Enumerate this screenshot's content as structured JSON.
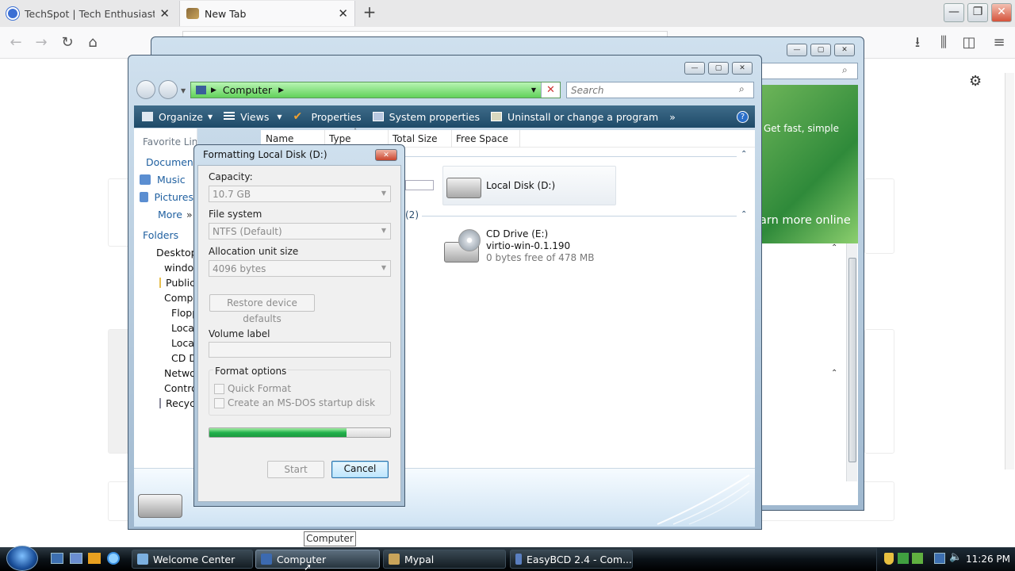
{
  "browser": {
    "tabs": [
      {
        "title": "TechSpot | Tech Enthusiasts, P",
        "active": false
      },
      {
        "title": "New Tab",
        "active": true
      }
    ],
    "new_tab_icon": "plus-icon",
    "toolbar_icons": [
      "back-arrow-icon",
      "forward-arrow-icon",
      "reload-icon",
      "home-icon",
      "download-icon",
      "library-icon",
      "sidebar-icon",
      "menu-icon"
    ]
  },
  "explorer": {
    "breadcrumb": "Computer",
    "search_placeholder": "Search",
    "toolbar": {
      "organize": "Organize",
      "views": "Views",
      "properties": "Properties",
      "system_properties": "System properties",
      "uninstall": "Uninstall or change a program",
      "more": "»"
    },
    "favorite_links": {
      "heading": "Favorite Links",
      "items": [
        "Documents",
        "Music",
        "Pictures",
        "More"
      ]
    },
    "folders": {
      "heading": "Folders",
      "items": [
        "Desktop",
        "windows",
        "Public",
        "Computer",
        "Floppy",
        "Local Disk",
        "Local Disk",
        "CD Drive",
        "Network",
        "Control Panel",
        "Recycle Bin"
      ]
    },
    "columns": [
      "Name",
      "Type",
      "Total Size",
      "Free Space"
    ],
    "group_count": "(2)",
    "drives": {
      "local_d": "Local Disk (D:)",
      "cd_name": "CD Drive (E:)",
      "cd_label": "virtio-win-0.1.190",
      "cd_free": "0 bytes free of 478 MB"
    }
  },
  "welcome_window": {
    "banner_text": "Get fast, simple",
    "learn_more": "arn more online"
  },
  "dialog": {
    "title": "Formatting Local Disk (D:)",
    "capacity_label": "Capacity:",
    "capacity_value": "10.7 GB",
    "filesystem_label": "File system",
    "filesystem_value": "NTFS (Default)",
    "allocation_label": "Allocation unit size",
    "allocation_value": "4096 bytes",
    "restore_button": "Restore device defaults",
    "volume_label": "Volume label",
    "volume_value": "",
    "format_options_label": "Format options",
    "quick_format": "Quick Format",
    "msdos_disk": "Create an MS-DOS startup disk",
    "progress": 0.76,
    "start_button": "Start",
    "cancel_button": "Cancel"
  },
  "taskbar": {
    "buttons": [
      "Welcome Center",
      "Computer",
      "Mypal",
      "EasyBCD 2.4 - Com..."
    ],
    "tooltip": "Computer",
    "clock": "11:26 PM"
  },
  "colors": {
    "progress_green": "#22b14c",
    "toolbar_blue": "#2b587a",
    "address_green": "#7fdc78"
  }
}
